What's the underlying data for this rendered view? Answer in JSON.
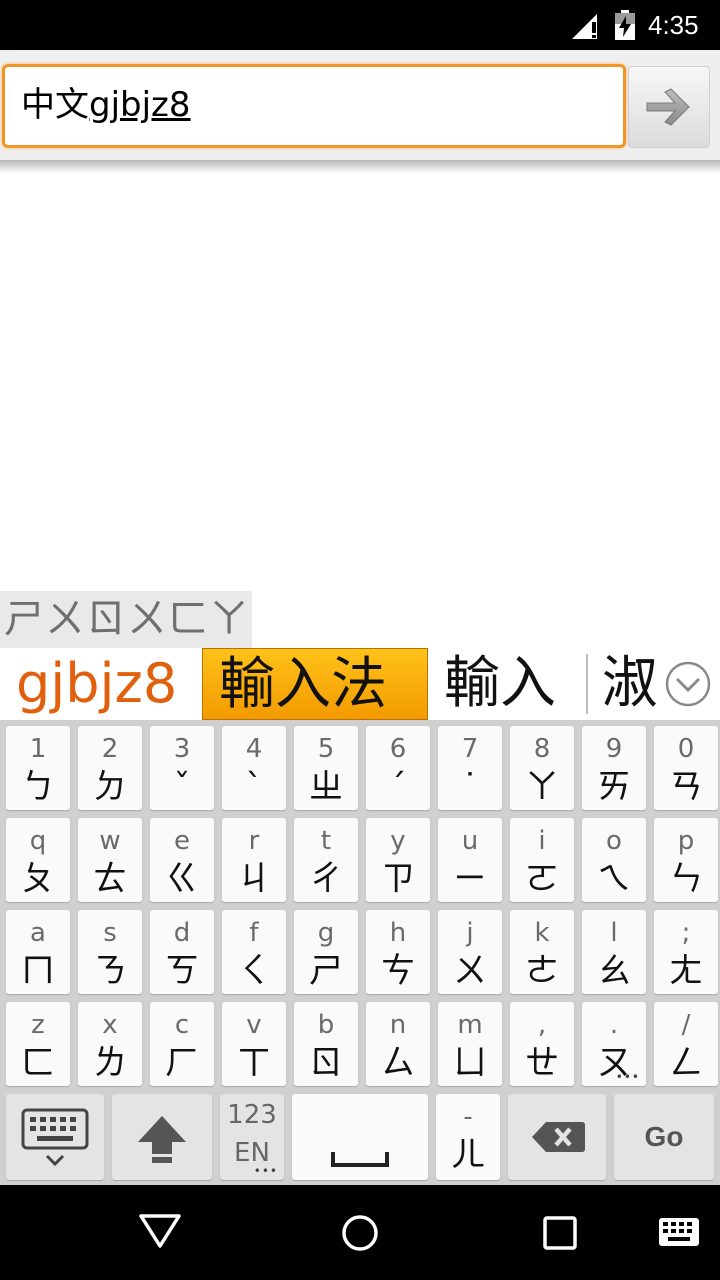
{
  "status_bar": {
    "time": "4:35",
    "icons": [
      "signal-no-data-icon",
      "battery-charging-icon"
    ]
  },
  "search": {
    "value_prefix": "中文",
    "value_composing": "gjbjz8",
    "submit_icon": "arrow-right-icon"
  },
  "composing": {
    "text": "ㄕㄨㄖㄨㄈㄚ"
  },
  "candidates": {
    "raw": "gjbjz8",
    "items": [
      "輸入法",
      "輸入",
      "淑"
    ],
    "expand_icon": "chevron-down-circle-icon"
  },
  "keyboard": {
    "rows": [
      [
        {
          "top": "1",
          "main": "ㄅ"
        },
        {
          "top": "2",
          "main": "ㄉ"
        },
        {
          "top": "3",
          "main": "ˇ"
        },
        {
          "top": "4",
          "main": "ˋ"
        },
        {
          "top": "5",
          "main": "ㄓ"
        },
        {
          "top": "6",
          "main": "ˊ"
        },
        {
          "top": "7",
          "main": "˙"
        },
        {
          "top": "8",
          "main": "ㄚ"
        },
        {
          "top": "9",
          "main": "ㄞ"
        },
        {
          "top": "0",
          "main": "ㄢ"
        }
      ],
      [
        {
          "top": "q",
          "main": "ㄆ"
        },
        {
          "top": "w",
          "main": "ㄊ"
        },
        {
          "top": "e",
          "main": "ㄍ"
        },
        {
          "top": "r",
          "main": "ㄐ"
        },
        {
          "top": "t",
          "main": "ㄔ"
        },
        {
          "top": "y",
          "main": "ㄗ"
        },
        {
          "top": "u",
          "main": "ㄧ"
        },
        {
          "top": "i",
          "main": "ㄛ"
        },
        {
          "top": "o",
          "main": "ㄟ"
        },
        {
          "top": "p",
          "main": "ㄣ"
        }
      ],
      [
        {
          "top": "a",
          "main": "ㄇ"
        },
        {
          "top": "s",
          "main": "ㄋ"
        },
        {
          "top": "d",
          "main": "ㄎ"
        },
        {
          "top": "f",
          "main": "ㄑ"
        },
        {
          "top": "g",
          "main": "ㄕ"
        },
        {
          "top": "h",
          "main": "ㄘ"
        },
        {
          "top": "j",
          "main": "ㄨ"
        },
        {
          "top": "k",
          "main": "ㄜ"
        },
        {
          "top": "l",
          "main": "ㄠ"
        },
        {
          "top": ";",
          "main": "ㄤ"
        }
      ],
      [
        {
          "top": "z",
          "main": "ㄈ"
        },
        {
          "top": "x",
          "main": "ㄌ"
        },
        {
          "top": "c",
          "main": "ㄏ"
        },
        {
          "top": "v",
          "main": "ㄒ"
        },
        {
          "top": "b",
          "main": "ㄖ"
        },
        {
          "top": "n",
          "main": "ㄙ"
        },
        {
          "top": "m",
          "main": "ㄩ"
        },
        {
          "top": ",",
          "main": "ㄝ"
        },
        {
          "top": ".",
          "main": "ㄡ"
        },
        {
          "top": "/",
          "main": "ㄥ"
        }
      ]
    ],
    "bottom": {
      "keyboard_icon": "keyboard-hide-icon",
      "shift_icon": "shift-arrow-icon",
      "mode_top": "123",
      "mode_bottom": "EN",
      "space_icon": "space-bar-icon",
      "er_top": "-",
      "er_main": "ㄦ",
      "backspace_icon": "backspace-icon",
      "go_label": "Go"
    }
  },
  "nav_bar": {
    "icons": [
      "back-triangle-icon",
      "home-circle-icon",
      "recents-square-icon",
      "keyboard-switch-icon"
    ]
  }
}
